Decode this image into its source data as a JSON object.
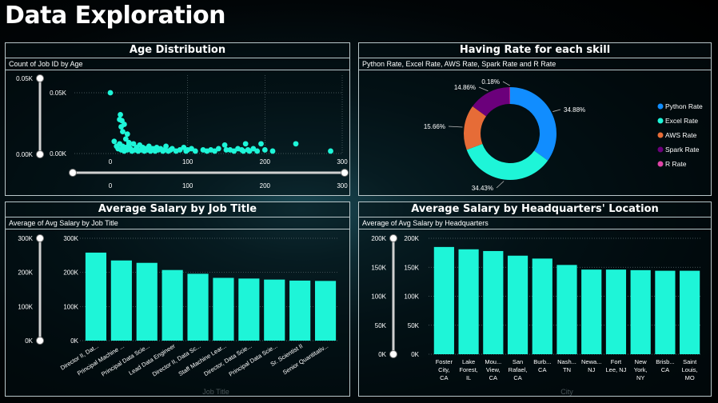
{
  "page": {
    "title": "Data Exploration"
  },
  "colors": {
    "accent": "#1ef5d8",
    "background": "#000000"
  },
  "panels": {
    "age": {
      "title": "Age Distribution",
      "subtitle": "Count of Job ID by Age"
    },
    "skill": {
      "title": "Having Rate for each skill",
      "subtitle": "Python Rate, Excel Rate, AWS Rate, Spark Rate and R Rate"
    },
    "job": {
      "title": "Average Salary by Job Title",
      "subtitle": "Average of Avg Salary by Job Title"
    },
    "hq": {
      "title": "Average Salary by Headquarters' Location",
      "subtitle": "Average of Avg Salary by Headquarters"
    }
  },
  "chart_data": [
    {
      "id": "age",
      "type": "scatter",
      "xlabel": "",
      "ylabel": "",
      "xlim": [
        0,
        300
      ],
      "ylim": [
        0,
        50
      ],
      "x_ticks": [
        "0",
        "100",
        "200",
        "300"
      ],
      "y_ticks": [
        "0.00K",
        "0.05K"
      ],
      "slider_ticks": [
        "0",
        "100",
        "200",
        "300"
      ],
      "points": [
        [
          0,
          50
        ],
        [
          12,
          28
        ],
        [
          13,
          32
        ],
        [
          14,
          22
        ],
        [
          15,
          27
        ],
        [
          16,
          18
        ],
        [
          18,
          24
        ],
        [
          20,
          12
        ],
        [
          22,
          16
        ],
        [
          24,
          9
        ],
        [
          5,
          10
        ],
        [
          8,
          6
        ],
        [
          10,
          4
        ],
        [
          12,
          8
        ],
        [
          14,
          3
        ],
        [
          16,
          6
        ],
        [
          18,
          2
        ],
        [
          20,
          5
        ],
        [
          22,
          3
        ],
        [
          24,
          7
        ],
        [
          26,
          4
        ],
        [
          28,
          2
        ],
        [
          30,
          8
        ],
        [
          32,
          3
        ],
        [
          34,
          5
        ],
        [
          36,
          2
        ],
        [
          38,
          7
        ],
        [
          40,
          3
        ],
        [
          42,
          5
        ],
        [
          44,
          2
        ],
        [
          46,
          4
        ],
        [
          48,
          3
        ],
        [
          50,
          6
        ],
        [
          52,
          2
        ],
        [
          55,
          4
        ],
        [
          58,
          2
        ],
        [
          60,
          5
        ],
        [
          62,
          3
        ],
        [
          65,
          4
        ],
        [
          68,
          2
        ],
        [
          70,
          3
        ],
        [
          72,
          6
        ],
        [
          75,
          2
        ],
        [
          78,
          3
        ],
        [
          80,
          4
        ],
        [
          85,
          2
        ],
        [
          90,
          3
        ],
        [
          95,
          5
        ],
        [
          98,
          2
        ],
        [
          100,
          3
        ],
        [
          105,
          4
        ],
        [
          110,
          2
        ],
        [
          120,
          3
        ],
        [
          125,
          2
        ],
        [
          130,
          3
        ],
        [
          135,
          2
        ],
        [
          140,
          4
        ],
        [
          148,
          7
        ],
        [
          150,
          3
        ],
        [
          155,
          3
        ],
        [
          160,
          2
        ],
        [
          165,
          4
        ],
        [
          170,
          3
        ],
        [
          172,
          2
        ],
        [
          175,
          8
        ],
        [
          178,
          3
        ],
        [
          180,
          2
        ],
        [
          185,
          4
        ],
        [
          190,
          2
        ],
        [
          195,
          8
        ],
        [
          200,
          3
        ],
        [
          210,
          2
        ],
        [
          240,
          8
        ],
        [
          285,
          2
        ]
      ]
    },
    {
      "id": "skill",
      "type": "pie",
      "donut": true,
      "slices": [
        {
          "name": "Python Rate",
          "value": 34.88,
          "label": "34.88%",
          "color": "#118dff"
        },
        {
          "name": "Excel Rate",
          "value": 34.43,
          "label": "34.43%",
          "color": "#1ef5d8"
        },
        {
          "name": "AWS Rate",
          "value": 15.66,
          "label": "15.66%",
          "color": "#e66c37"
        },
        {
          "name": "Spark Rate",
          "value": 14.86,
          "label": "14.86%",
          "color": "#6b007b"
        },
        {
          "name": "R Rate",
          "value": 0.18,
          "label": "0.18%",
          "color": "#e044a7"
        }
      ]
    },
    {
      "id": "job",
      "type": "bar",
      "xlabel": "Job Title",
      "ylabel": "",
      "ylim": [
        0,
        300000
      ],
      "y_ticks": [
        "0K",
        "100K",
        "200K",
        "300K"
      ],
      "slider_ticks": [
        "0K",
        "100K",
        "200K",
        "300K"
      ],
      "categories": [
        "Director II, Dat...",
        "Principal Machine ...",
        "Principal Data Scie...",
        "Lead Data Engineer",
        "Director II, Data Sc...",
        "Staff Machine Lear...",
        "Director, Data Scie...",
        "Principal Data Scie...",
        "Sr. Scientist II",
        "Senior Quantitativ..."
      ],
      "values": [
        258000,
        235000,
        228000,
        207000,
        196000,
        184000,
        182000,
        179000,
        176000,
        175000
      ]
    },
    {
      "id": "hq",
      "type": "bar",
      "xlabel": "City",
      "ylabel": "",
      "ylim": [
        0,
        200000
      ],
      "y_ticks": [
        "0K",
        "50K",
        "100K",
        "150K",
        "200K"
      ],
      "slider_ticks": [
        "0K",
        "50K",
        "100K",
        "150K",
        "200K"
      ],
      "categories": [
        "Foster City, CA",
        "Lake Forest, IL",
        "Mou... View, CA",
        "San Rafael, CA",
        "Burb... CA",
        "Nash... TN",
        "Newa... NJ",
        "Fort Lee, NJ",
        "New York, NY",
        "Brisb... CA",
        "Saint Louis, MO"
      ],
      "category_lines": [
        [
          "Foster",
          "City,",
          "CA"
        ],
        [
          "Lake",
          "Forest,",
          "IL"
        ],
        [
          "Mou...",
          "View,",
          "CA"
        ],
        [
          "San",
          "Rafael,",
          "CA"
        ],
        [
          "Burb...",
          "CA"
        ],
        [
          "Nash...",
          "TN"
        ],
        [
          "Newa...",
          "NJ"
        ],
        [
          "Fort",
          "Lee, NJ"
        ],
        [
          "New",
          "York,",
          "NY"
        ],
        [
          "Brisb...",
          "CA"
        ],
        [
          "Saint",
          "Louis,",
          "MO"
        ]
      ],
      "values": [
        185000,
        181000,
        178000,
        170000,
        165000,
        154000,
        146000,
        146000,
        145000,
        144000,
        144000
      ]
    }
  ]
}
